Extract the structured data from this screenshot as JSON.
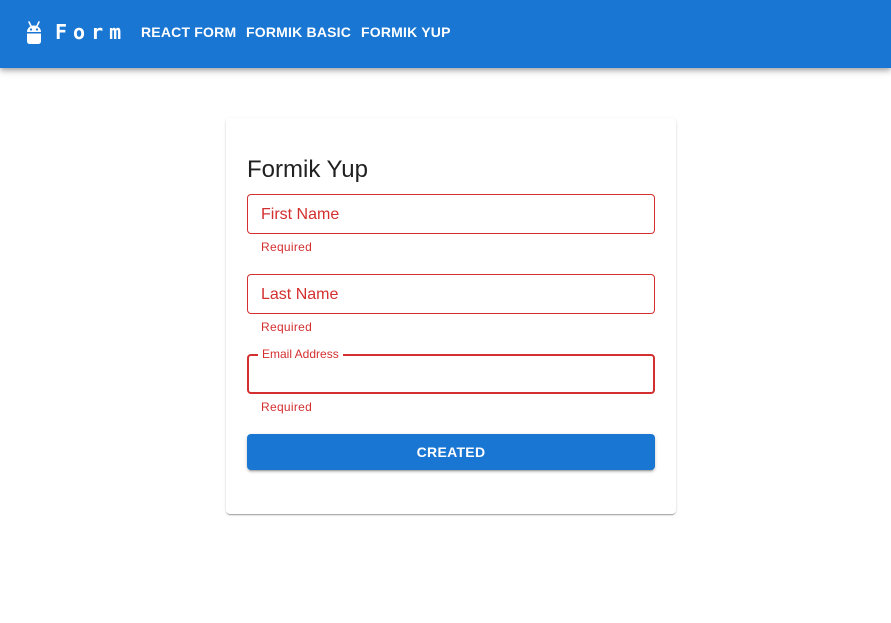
{
  "app": {
    "brand": "Form",
    "brand_icon": "android-icon",
    "nav": [
      {
        "label": "React Form"
      },
      {
        "label": "Formik Basic"
      },
      {
        "label": "Formik Yup"
      }
    ]
  },
  "form": {
    "title": "Formik Yup",
    "fields": [
      {
        "label": "First Name",
        "value": "",
        "helper": "Required",
        "state": "error"
      },
      {
        "label": "Last Name",
        "value": "",
        "helper": "Required",
        "state": "error"
      },
      {
        "label": "Email Address",
        "value": "",
        "helper": "Required",
        "state": "error-focused"
      }
    ],
    "submit_label": "Created"
  },
  "colors": {
    "primary": "#1976d2",
    "error": "#d32f2f",
    "title_text": "#212121"
  }
}
